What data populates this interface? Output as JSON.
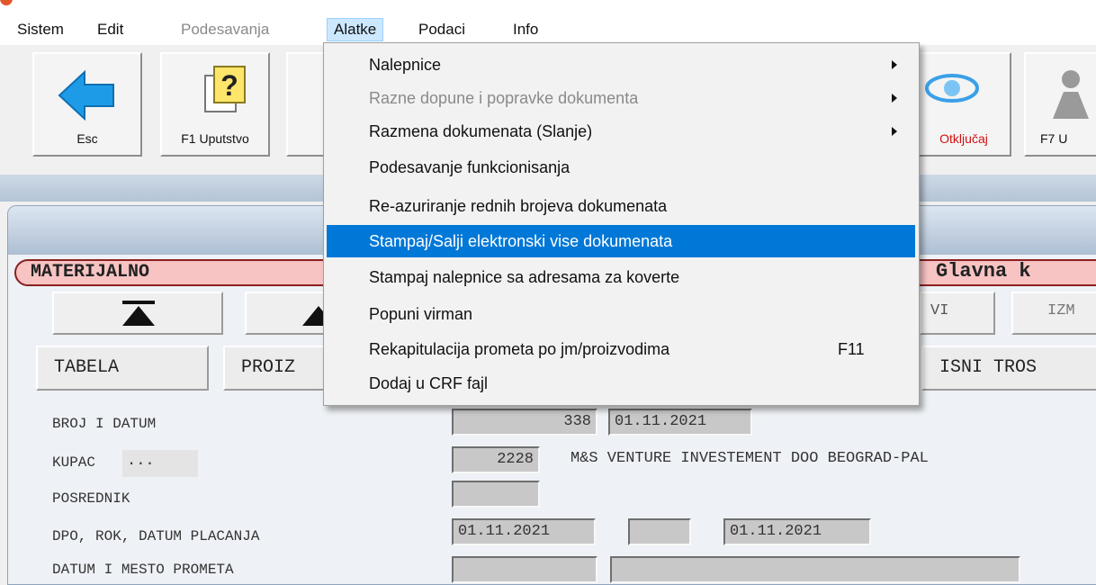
{
  "menubar": {
    "items": [
      {
        "label": "Sistem",
        "state": "normal"
      },
      {
        "label": "Edit",
        "state": "normal"
      },
      {
        "label": "Podesavanja",
        "state": "disabled"
      },
      {
        "label": "Alatke",
        "state": "open"
      },
      {
        "label": "Podaci",
        "state": "normal"
      },
      {
        "label": "Info",
        "state": "normal"
      }
    ]
  },
  "toolbar": {
    "esc_label": "Esc",
    "f1_label": "F1 Uputstvo",
    "unlock_label": "Otključaj",
    "f7_label": "F7 U"
  },
  "dropdown": {
    "items": [
      {
        "label": "Nalepnice",
        "submenu": true
      },
      {
        "label": "Razne dopune i popravke dokumenta",
        "submenu": true,
        "disabled": true
      },
      {
        "label": "Razmena dokumenata (Slanje)",
        "submenu": true
      },
      {
        "label": "Podesavanje funkcionisanja"
      },
      {
        "label": "Re-azuriranje rednih brojeva dokumenata"
      },
      {
        "label": "Stampaj/Salji elektronski vise dokumenata",
        "selected": true
      },
      {
        "label": "Stampaj nalepnice sa adresama za koverte"
      },
      {
        "label": "Popuni virman"
      },
      {
        "label": "Rekapitulacija prometa po jm/proizvodima",
        "shortcut": "F11"
      },
      {
        "label": "Dodaj u CRF fajl"
      }
    ]
  },
  "panel": {
    "section": "MATERIJALNO",
    "right_title": "Glavna k",
    "nav_right1": "VI",
    "nav_right2": "IZM",
    "tabs": {
      "tabela": "TABELA",
      "proiz": "PROIZ",
      "troskovi": "ISNI TROS"
    },
    "fields": {
      "broj_label": "BROJ I DATUM",
      "broj_value": "338",
      "broj_date": "01.11.2021",
      "kupac_label": "KUPAC",
      "kupac_dots": "...",
      "kupac_value": "2228",
      "kupac_name": "M&S VENTURE INVESTEMENT DOO BEOGRAD-PAL",
      "posrednik_label": "POSREDNIK",
      "dpo_label": "DPO, ROK, DATUM PLACANJA",
      "dpo_date": "01.11.2021",
      "rok_date": "01.11.2021",
      "datum_mesto_label": "DATUM I MESTO PROMETA"
    }
  },
  "colors": {
    "selection": "#0078d7",
    "menu_open": "#cce8ff",
    "pill": "#f7c3c3",
    "unlock_text": "#d01010",
    "arrow_blue": "#1e9be6"
  }
}
